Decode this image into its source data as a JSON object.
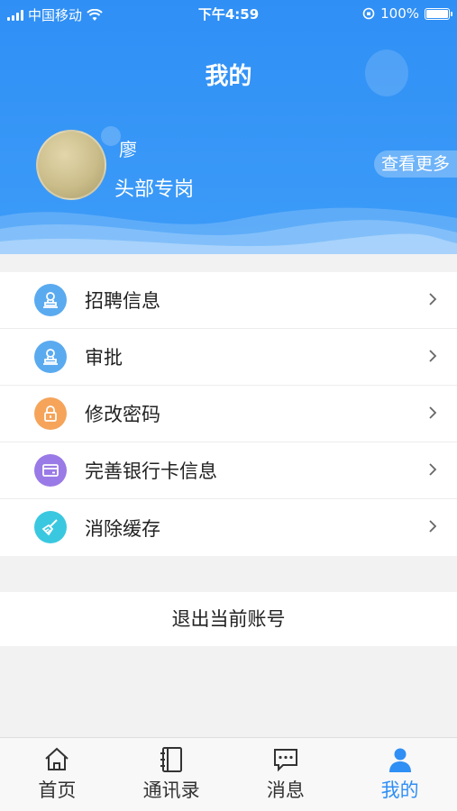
{
  "status_bar": {
    "carrier": "中国移动",
    "time": "下午4:59",
    "battery": "100%"
  },
  "header": {
    "title": "我的",
    "user_name": "廖",
    "user_role": "头部专岗",
    "more_label": "查看更多"
  },
  "menu": {
    "items": [
      {
        "label": "招聘信息",
        "icon": "user-stamp-icon",
        "color": "#5aaaf0"
      },
      {
        "label": "审批",
        "icon": "user-stamp-icon",
        "color": "#5aaaf0"
      },
      {
        "label": "修改密码",
        "icon": "lock-icon",
        "color": "#f5a45a"
      },
      {
        "label": "完善银行卡信息",
        "icon": "card-icon",
        "color": "#9a7ae6"
      },
      {
        "label": "消除缓存",
        "icon": "broom-icon",
        "color": "#3ac8e0"
      }
    ]
  },
  "logout": {
    "label": "退出当前账号"
  },
  "tabbar": {
    "items": [
      {
        "label": "首页",
        "icon": "home-icon",
        "active": false
      },
      {
        "label": "通讯录",
        "icon": "contacts-icon",
        "active": false
      },
      {
        "label": "消息",
        "icon": "message-icon",
        "active": false
      },
      {
        "label": "我的",
        "icon": "person-icon",
        "active": true
      }
    ],
    "active_color": "#2f8ff5"
  }
}
